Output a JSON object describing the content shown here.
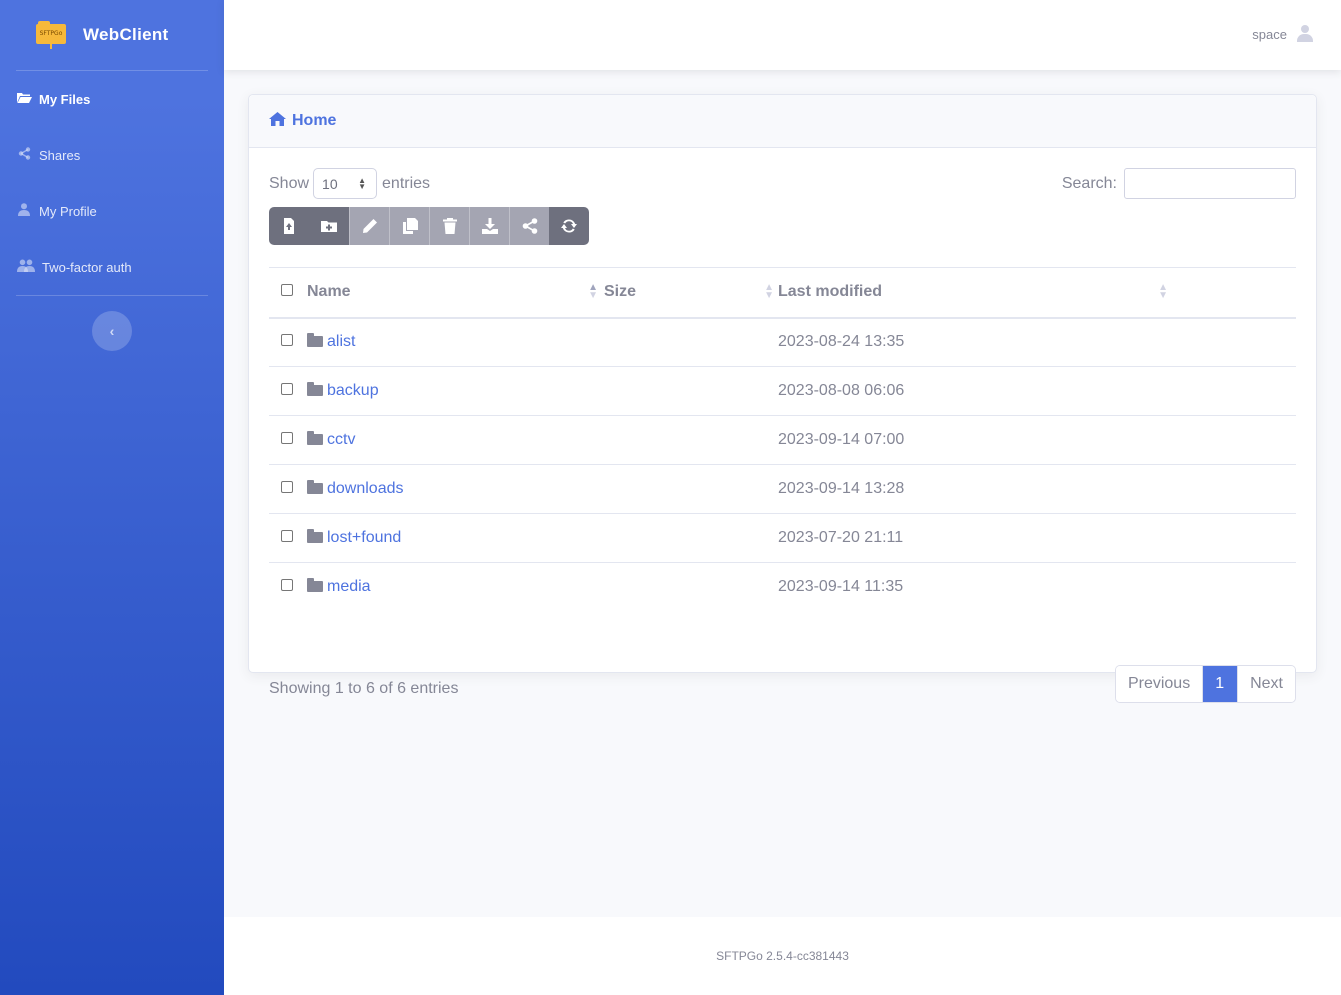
{
  "sidebar": {
    "brand_logo_text": "SFTPGo",
    "brand": "WebClient",
    "items": [
      {
        "label": "My Files",
        "icon": "folder-open-icon"
      },
      {
        "label": "Shares",
        "icon": "share-icon"
      },
      {
        "label": "My Profile",
        "icon": "user-icon"
      },
      {
        "label": "Two-factor auth",
        "icon": "users-icon"
      }
    ],
    "toggle_icon": "chevron-left-icon"
  },
  "topbar": {
    "username": "space"
  },
  "card": {
    "title": "Home",
    "length": {
      "show": "Show",
      "value": "10",
      "entries": "entries"
    },
    "search": {
      "label": "Search:",
      "value": ""
    },
    "toolbar": [
      "upload-file-icon",
      "add-folder-icon",
      "rename-icon",
      "copy-icon",
      "delete-icon",
      "download-icon",
      "share-icon",
      "refresh-icon"
    ],
    "columns": {
      "name": "Name",
      "size": "Size",
      "modified": "Last modified"
    },
    "rows": [
      {
        "name": "alist",
        "size": "",
        "modified": "2023-08-24 13:35"
      },
      {
        "name": "backup",
        "size": "",
        "modified": "2023-08-08 06:06"
      },
      {
        "name": "cctv",
        "size": "",
        "modified": "2023-09-14 07:00"
      },
      {
        "name": "downloads",
        "size": "",
        "modified": "2023-09-14 13:28"
      },
      {
        "name": "lost+found",
        "size": "",
        "modified": "2023-07-20 21:11"
      },
      {
        "name": "media",
        "size": "",
        "modified": "2023-09-14 11:35"
      }
    ],
    "info": "Showing 1 to 6 of 6 entries",
    "pager": {
      "previous": "Previous",
      "current": "1",
      "next": "Next"
    }
  },
  "footer": {
    "version": "SFTPGo 2.5.4-cc381443"
  },
  "colors": {
    "primary": "#4e73df",
    "sidebar_end": "#224abe",
    "text_muted": "#858796"
  }
}
